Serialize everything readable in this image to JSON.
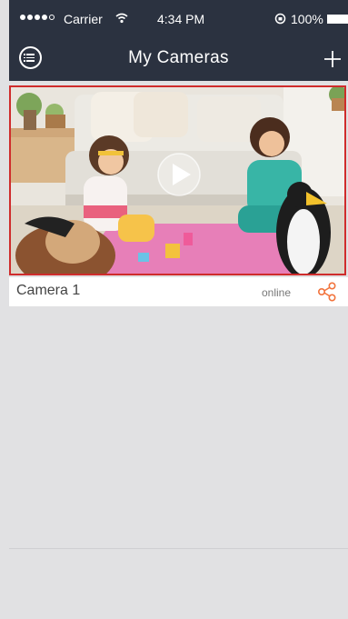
{
  "status_bar": {
    "carrier": "Carrier",
    "time": "4:34 PM",
    "battery": "100%"
  },
  "navbar": {
    "title": "My Cameras"
  },
  "cameras": [
    {
      "name": "Camera 1",
      "status": "online"
    }
  ],
  "colors": {
    "header_bg": "#2b3240",
    "selection_border": "#cf2c2c",
    "accent": "#f2733c",
    "page_bg": "#e1e1e3"
  },
  "icons": {
    "menu": "menu-icon",
    "add": "plus-icon",
    "play": "play-icon",
    "share": "share-icon"
  }
}
